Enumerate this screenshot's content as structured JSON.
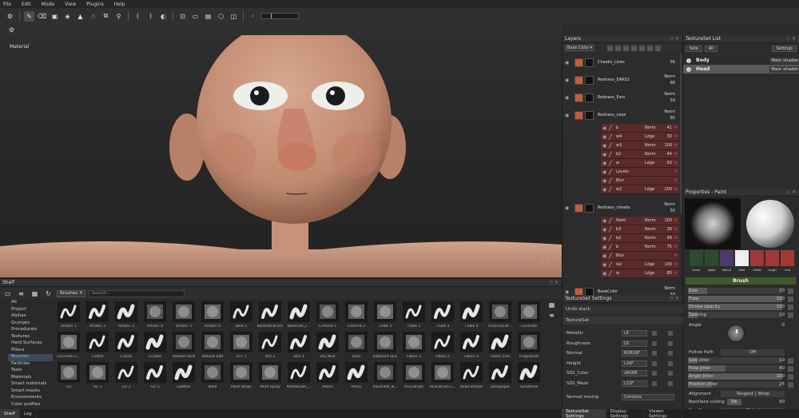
{
  "menu": [
    "File",
    "Edit",
    "Mode",
    "View",
    "Plugins",
    "Help"
  ],
  "toolbar": {
    "slider_value": "8"
  },
  "viewport": {
    "label": "Material",
    "axis": "Z",
    "axis2": "X"
  },
  "shelf": {
    "title": "Shelf",
    "filter_chip": "Brushes",
    "search_placeholder": "Search...",
    "categories": [
      "All",
      "Project",
      "Alphas",
      "Grunges",
      "Procedurals",
      "Textures",
      "Hard Surfaces",
      "Filters",
      "Brushes",
      "Particles",
      "Tools",
      "Materials",
      "Smart materials",
      "Smart masks",
      "Environments",
      "Color profiles"
    ],
    "selected_category": "Brushes",
    "brushes": [
      "Artistic 1",
      "Artistic 2",
      "Artistic 3",
      "Artistic 4",
      "Artistic 5",
      "Artistic 6",
      "Bark 1",
      "Basmati Brush",
      "BlackSilk_F...",
      "Cement 1",
      "Cement 2",
      "Chalk 1",
      "Chalk 2",
      "Chalk 3",
      "Chalk 4",
      "Charcoal Br...",
      "Concrete",
      "Concrete Li...",
      "Cotton",
      "Cracks",
      "Crystal",
      "Default Hard",
      "Default Soft",
      "Dirt 1",
      "Dirt 2",
      "Dirt 3",
      "Dry Mud",
      "Dust",
      "Elephant Skin",
      "Fibers 1",
      "Fibers 2",
      "Fibers 3",
      "Fibers Line",
      "Fingerprint",
      "Fur",
      "Fur 1",
      "Fur 2",
      "Fur 3",
      "Leather",
      "Mold",
      "Paint Drops",
      "Paint Spray",
      "PaintBrush_...",
      "Pearls",
      "Pencil",
      "Ravenhill_w...",
      "Rice Brush",
      "Rice Brush L...",
      "Road Stripes",
      "Sandpaper",
      "Scratches"
    ],
    "selected_brush": "Dirt 1",
    "tabs": [
      "Shelf",
      "Log"
    ]
  },
  "layers": {
    "title": "Layers",
    "channel": "Base Color",
    "rows": [
      {
        "type": "big",
        "name": "Cheeks_Lines",
        "blend": "",
        "value": "56"
      },
      {
        "type": "big",
        "name": "Redness_EARS2",
        "blend": "Norm",
        "value": "66"
      },
      {
        "type": "big",
        "name": "Redness_Ears",
        "blend": "Norm",
        "value": "59"
      },
      {
        "type": "big",
        "name": "Redness_nose",
        "blend": "Norm",
        "value": "65"
      },
      {
        "type": "sub",
        "name": "b",
        "blend": "Norm",
        "value": "41"
      },
      {
        "type": "sub",
        "name": "w4",
        "blend": "Ldge",
        "value": "30"
      },
      {
        "type": "sub",
        "name": "w3",
        "blend": "Norm",
        "value": "100"
      },
      {
        "type": "sub",
        "name": "b2",
        "blend": "Norm",
        "value": "44"
      },
      {
        "type": "sub",
        "name": "w",
        "blend": "Ldge",
        "value": "63"
      },
      {
        "type": "sub",
        "name": "Levels",
        "blend": "",
        "value": ""
      },
      {
        "type": "sub",
        "name": "Blur",
        "blend": "",
        "value": ""
      },
      {
        "type": "sub",
        "name": "w2",
        "blend": "Ldge",
        "value": "100"
      },
      {
        "type": "gap",
        "name": "",
        "blend": "",
        "value": ""
      },
      {
        "type": "big",
        "name": "Redness_cheeks",
        "blend": "Norm",
        "value": "50"
      },
      {
        "type": "sub",
        "name": "Paint",
        "blend": "Norm",
        "value": "100"
      },
      {
        "type": "sub",
        "name": "b3",
        "blend": "Norm",
        "value": "28"
      },
      {
        "type": "sub",
        "name": "b2",
        "blend": "Norm",
        "value": "48"
      },
      {
        "type": "sub",
        "name": "b",
        "blend": "Norm",
        "value": "75"
      },
      {
        "type": "sub",
        "name": "Blur",
        "blend": "",
        "value": ""
      },
      {
        "type": "sub",
        "name": "w2",
        "blend": "Ldge",
        "value": "100"
      },
      {
        "type": "sub",
        "name": "w",
        "blend": "Ldge",
        "value": "85"
      },
      {
        "type": "gap",
        "name": "",
        "blend": "",
        "value": ""
      },
      {
        "type": "big",
        "name": "BaseColor",
        "blend": "Norm",
        "value": "50"
      },
      {
        "type": "big",
        "name": "Colorlayer",
        "blend": "",
        "value": ""
      }
    ]
  },
  "textureset_list": {
    "title": "TextureSet List",
    "solo": "Solo",
    "all": "All",
    "settings": "Settings",
    "sets": [
      {
        "name": "Body",
        "shader": "Main shader"
      },
      {
        "name": "Head",
        "shader": "Main shader"
      }
    ]
  },
  "properties": {
    "title": "Properties - Paint",
    "chips": [
      "brush",
      "alpha",
      "stencil",
      "color",
      "metal",
      "rough",
      "nrm"
    ],
    "section": "Brush",
    "rows": [
      {
        "label": "Size",
        "value": "20",
        "fill": 0.2
      },
      {
        "label": "Flow",
        "value": "100",
        "fill": 1.0
      },
      {
        "label": "Stroke opacity",
        "value": "100",
        "fill": 1.0
      },
      {
        "label": "Spacing",
        "value": "10",
        "fill": 0.1
      }
    ],
    "angle_label": "Angle",
    "angle_value": "0",
    "follow_path_label": "Follow Path",
    "follow_path_value": "Off",
    "jitter_rows": [
      {
        "label": "Size Jitter",
        "value": "10",
        "fill": 0.1
      },
      {
        "label": "Flow Jitter",
        "value": "40",
        "fill": 0.4
      },
      {
        "label": "Angle Jitter",
        "value": "100",
        "fill": 1.0
      },
      {
        "label": "Position Jitter",
        "value": "25",
        "fill": 0.25
      }
    ],
    "alignment_label": "Alignment",
    "alignment_value": "Tangent | Wrap",
    "backface_label": "Backface culling",
    "backface_toggle": "On",
    "backface_value": "90",
    "sizespace_label": "Size Space",
    "sizespace_value": "Object"
  },
  "textureset_settings": {
    "title": "TextureSet Settings",
    "undo": "Undo stack",
    "section": "TextureSet",
    "channels": [
      {
        "name": "Metallic",
        "format": "L8"
      },
      {
        "name": "Roughness",
        "format": "L8"
      },
      {
        "name": "Normal",
        "format": "RGB16F"
      },
      {
        "name": "Height",
        "format": "L16F"
      },
      {
        "name": "SSS_Color",
        "format": "sRGB8"
      },
      {
        "name": "SSS_Mask",
        "format": "L32F"
      }
    ],
    "normal_mixing_label": "Normal mixing",
    "normal_mixing_value": "Combine",
    "tabs": [
      "TextureSet Settings",
      "Display Settings",
      "Viewer Settings"
    ]
  },
  "colors": {
    "accent_green": "#3f5a2a",
    "layer_sub": "#5a2a2a",
    "skin": "#c8957a"
  }
}
